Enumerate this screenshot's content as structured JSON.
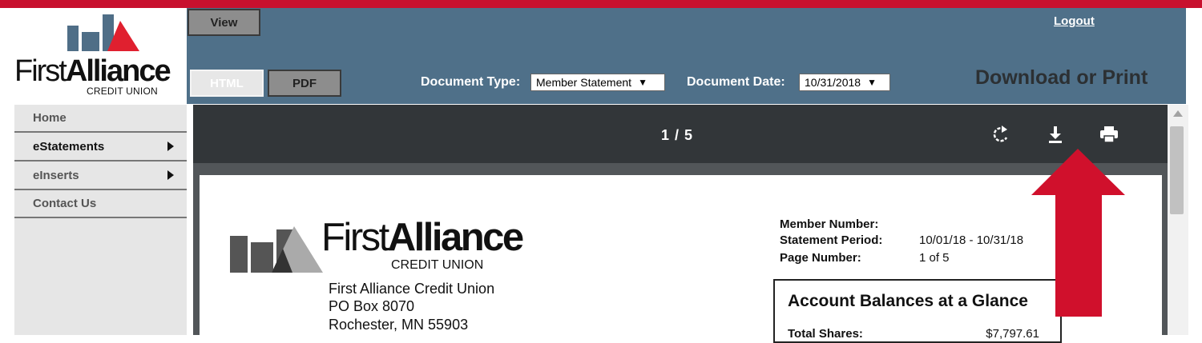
{
  "brand": {
    "name_first": "First",
    "name_bold": "Alliance",
    "subtitle": "CREDIT UNION"
  },
  "toolbar": {
    "view_label": "View",
    "html_label": "HTML",
    "pdf_label": "PDF",
    "logout_label": "Logout",
    "doc_type_label": "Document Type:",
    "doc_type_value": "Member Statement",
    "doc_date_label": "Document Date:",
    "doc_date_value": "10/31/2018",
    "download_title": "Download or Print"
  },
  "sidebar": {
    "items": [
      {
        "label": "Home",
        "has_submenu": false
      },
      {
        "label": "eStatements",
        "has_submenu": true
      },
      {
        "label": "eInserts",
        "has_submenu": true
      },
      {
        "label": "Contact Us",
        "has_submenu": false
      }
    ]
  },
  "viewer": {
    "page_indicator": "1 / 5",
    "icons": [
      "rotate-icon",
      "download-icon",
      "print-icon"
    ]
  },
  "document": {
    "address": [
      "First Alliance Credit Union",
      "PO Box 8070",
      "Rochester, MN 55903"
    ],
    "member_info": {
      "member_number_label": "Member Number:",
      "member_number_value": "",
      "statement_period_label": "Statement Period:",
      "statement_period_value": "10/01/18 - 10/31/18",
      "page_number_label": "Page Number:",
      "page_number_value": "1 of 5"
    },
    "glance": {
      "title": "Account Balances at a Glance",
      "row_label": "Total Shares:",
      "row_value": "$7,797.61"
    }
  },
  "colors": {
    "top_stripe": "#c8102e",
    "toolbar": "#4f7089",
    "viewer_bar": "#323639",
    "arrow": "#d0102c"
  }
}
